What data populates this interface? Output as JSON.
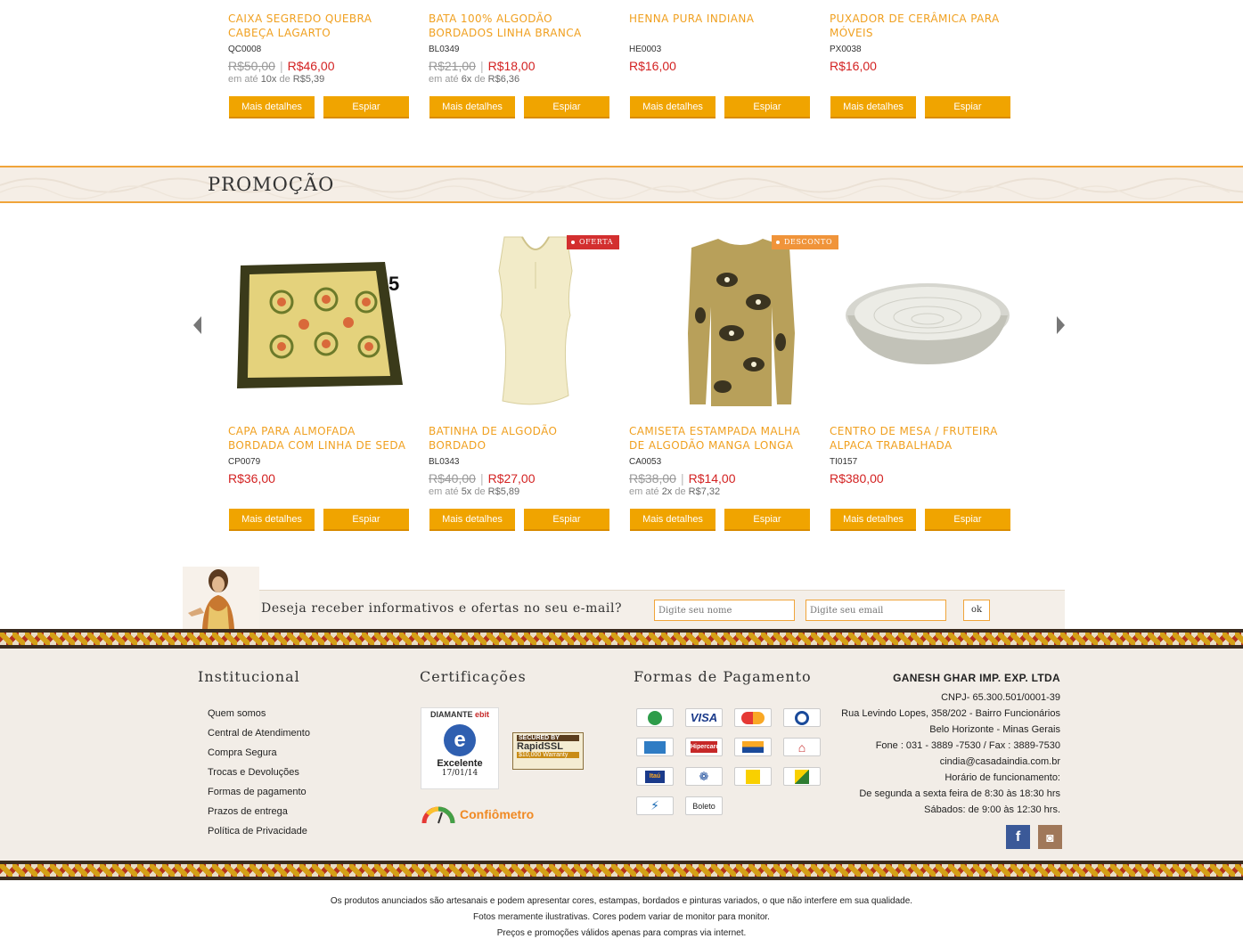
{
  "top_products": [
    {
      "name": "CAIXA SEGREDO QUEBRA CABEÇA LAGARTO",
      "sku": "QC0008",
      "old_price": "R$50,00",
      "price": "R$46,00",
      "inst_pre": "em até ",
      "inst_n": "10x",
      "inst_mid": " de ",
      "inst_val": "R$5,39"
    },
    {
      "name": "BATA 100% ALGODÃO BORDADOS LINHA BRANCA",
      "sku": "BL0349",
      "old_price": "R$21,00",
      "price": "R$18,00",
      "inst_pre": "em até ",
      "inst_n": "6x",
      "inst_mid": " de ",
      "inst_val": "R$6,36"
    },
    {
      "name": "HENNA PURA INDIANA",
      "sku": "HE0003",
      "old_price": "",
      "price": "R$16,00",
      "inst_pre": "",
      "inst_n": "",
      "inst_mid": "",
      "inst_val": ""
    },
    {
      "name": "PUXADOR DE CERÂMICA PARA MÓVEIS",
      "sku": "PX0038",
      "old_price": "",
      "price": "R$16,00",
      "inst_pre": "",
      "inst_n": "",
      "inst_mid": "",
      "inst_val": ""
    }
  ],
  "buttons": {
    "details": "Mais detalhes",
    "peek": "Espiar"
  },
  "promo": {
    "title": "PROMOÇÃO",
    "counter": "5",
    "tags": {
      "oferta": "OFERTA",
      "desconto": "DESCONTO"
    },
    "products": [
      {
        "name": "CAPA PARA ALMOFADA BORDADA COM LINHA DE SEDA",
        "sku": "CP0079",
        "old_price": "",
        "price": "R$36,00",
        "inst_pre": "",
        "inst_n": "",
        "inst_mid": "",
        "inst_val": ""
      },
      {
        "name": "BATINHA DE ALGODÃO BORDADO",
        "sku": "BL0343",
        "old_price": "R$40,00",
        "price": "R$27,00",
        "inst_pre": "em até ",
        "inst_n": "5x",
        "inst_mid": " de ",
        "inst_val": "R$5,89"
      },
      {
        "name": "CAMISETA ESTAMPADA MALHA DE ALGODÃO MANGA LONGA",
        "sku": "CA0053",
        "old_price": "R$38,00",
        "price": "R$14,00",
        "inst_pre": "em até ",
        "inst_n": "2x",
        "inst_mid": " de ",
        "inst_val": "R$7,32"
      },
      {
        "name": "CENTRO DE MESA / FRUTEIRA ALPACA TRABALHADA",
        "sku": "TI0157",
        "old_price": "",
        "price": "R$380,00",
        "inst_pre": "",
        "inst_n": "",
        "inst_mid": "",
        "inst_val": ""
      }
    ]
  },
  "newsletter": {
    "question": "Deseja receber informativos e ofertas no seu e-mail?",
    "name_placeholder": "Digite seu nome",
    "email_placeholder": "Digite seu email",
    "ok": "ok"
  },
  "footer": {
    "institucional_title": "Institucional",
    "links": [
      "Quem somos",
      "Central de Atendimento",
      "Compra Segura",
      "Trocas e Devoluções",
      "Formas de pagamento",
      "Prazos de entrega",
      "Política de Privacidade"
    ],
    "cert_title": "Certificações",
    "ebit": {
      "top": "DIAMANTE",
      "brand": "ebit",
      "rating": "Excelente",
      "date": "17/01/14"
    },
    "rapidssl": {
      "line1": "SECURED BY",
      "line2": "RapidSSL",
      "line3": "$10,000 Warranty"
    },
    "confiometro": "Confiômetro",
    "payment_title": "Formas de Pagamento",
    "payments": [
      "Elo",
      "VISA",
      "MasterCard",
      "Diners",
      "Amex",
      "Hipercard",
      "Aura",
      "Banrisul",
      "Itaú",
      "Bradesco",
      "Banco do Brasil",
      "HSBC",
      "Santander",
      "Boleto"
    ],
    "company": {
      "name": "GANESH GHAR IMP. EXP. LTDA",
      "cnpj": "CNPJ- 65.300.501/0001-39",
      "address": "Rua Levindo Lopes, 358/202 - Bairro Funcionários",
      "city": "Belo Horizonte - Minas Gerais",
      "phone": "Fone : 031 - 3889 -7530 / Fax : 3889-7530",
      "email": "cindia@casadaindia.com.br",
      "hours_title": "Horário de funcionamento:",
      "hours_week": "De segunda a sexta feira de 8:30 às 18:30 hrs",
      "hours_sat": "Sábados: de 9:00 às 12:30 hrs."
    },
    "social": {
      "facebook": "f",
      "instagram": "◙"
    }
  },
  "disclaimer": [
    "Os produtos anunciados são artesanais e podem apresentar cores, estampas, bordados e pinturas variados, o que não interfere em sua qualidade.",
    "Fotos meramente ilustrativas. Cores podem variar de monitor  para monitor.",
    "Preços e promoções válidos apenas para compras via internet."
  ],
  "colors": {
    "accent": "#f0a400",
    "name": "#f0a020",
    "price": "#d32222",
    "oferta": "#d32f2f",
    "desconto": "#f0943a"
  }
}
